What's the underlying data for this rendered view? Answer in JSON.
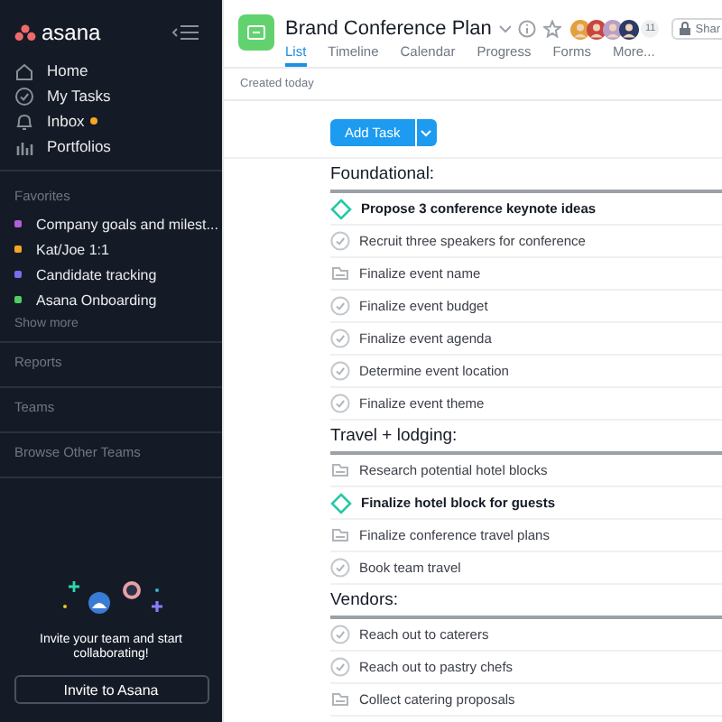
{
  "sidebar": {
    "logo": "asana",
    "nav": [
      {
        "label": "Home",
        "kind": "home",
        "notify": false
      },
      {
        "label": "My Tasks",
        "kind": "check",
        "notify": false
      },
      {
        "label": "Inbox",
        "kind": "bell",
        "notify": true
      },
      {
        "label": "Portfolios",
        "kind": "bars",
        "notify": false
      }
    ],
    "favorites_title": "Favorites",
    "favorites": [
      {
        "label": "Company goals and milest...",
        "color": "#b25fd9"
      },
      {
        "label": "Kat/Joe 1:1",
        "color": "#f5a623"
      },
      {
        "label": "Candidate tracking",
        "color": "#7b6cf0"
      },
      {
        "label": "Asana Onboarding",
        "color": "#4fcf5f"
      }
    ],
    "show_more": "Show more",
    "sections": [
      "Reports",
      "Teams",
      "Browse Other Teams"
    ],
    "invite_text": "Invite your team and start collaborating!",
    "invite_button": "Invite to Asana"
  },
  "project": {
    "title": "Brand Conference Plan",
    "member_count": "11",
    "share": "Shar",
    "tabs": [
      {
        "label": "List",
        "selected": true
      },
      {
        "label": "Timeline",
        "selected": false
      },
      {
        "label": "Calendar",
        "selected": false
      },
      {
        "label": "Progress",
        "selected": false
      },
      {
        "label": "Forms",
        "selected": false
      },
      {
        "label": "More...",
        "selected": false
      }
    ],
    "subtitle": "Created today"
  },
  "add_task": "Add Task",
  "sections": [
    {
      "title": "Foundational:",
      "tasks": [
        {
          "name": "Propose 3 conference keynote ideas",
          "kind": "milestone"
        },
        {
          "name": "Recruit three speakers for conference",
          "kind": "task"
        },
        {
          "name": "Finalize event name",
          "kind": "subtasks"
        },
        {
          "name": "Finalize event budget",
          "kind": "task"
        },
        {
          "name": "Finalize event agenda",
          "kind": "task"
        },
        {
          "name": "Determine event location",
          "kind": "task"
        },
        {
          "name": "Finalize event theme",
          "kind": "task"
        }
      ]
    },
    {
      "title": "Travel + lodging:",
      "tasks": [
        {
          "name": "Research potential hotel blocks",
          "kind": "subtasks"
        },
        {
          "name": "Finalize hotel block for guests",
          "kind": "milestone"
        },
        {
          "name": "Finalize conference travel plans",
          "kind": "subtasks"
        },
        {
          "name": "Book team travel",
          "kind": "task"
        }
      ]
    },
    {
      "title": "Vendors:",
      "tasks": [
        {
          "name": "Reach out to caterers",
          "kind": "task"
        },
        {
          "name": "Reach out to pastry chefs",
          "kind": "task"
        },
        {
          "name": "Collect catering proposals",
          "kind": "subtasks"
        }
      ]
    }
  ]
}
